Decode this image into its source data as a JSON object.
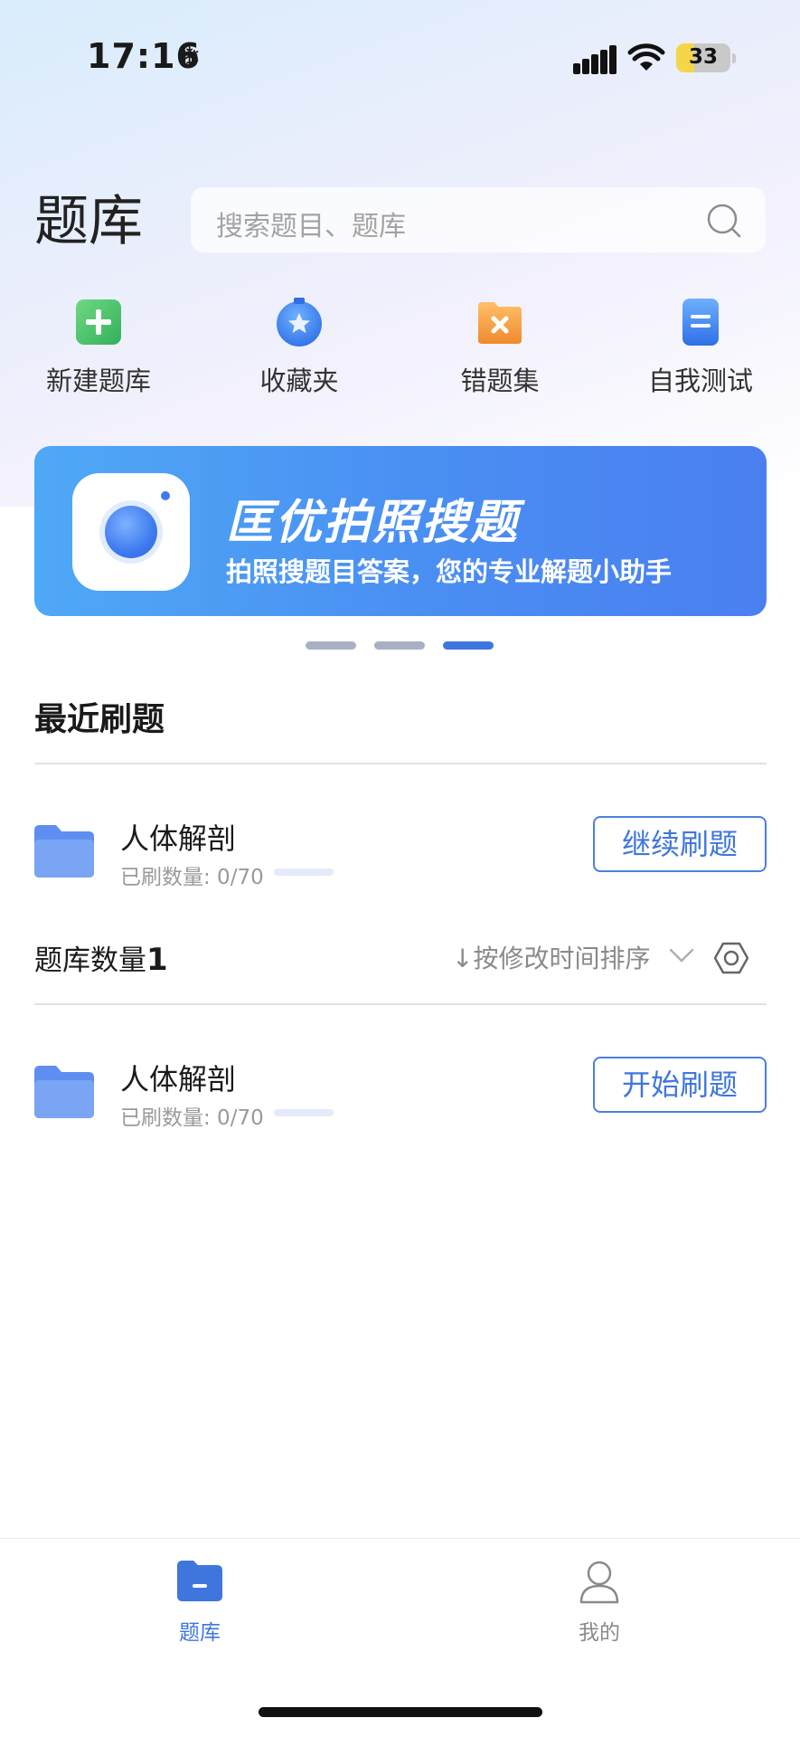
{
  "status_bar": {
    "time": "17:16",
    "time_icon": "snowflake-icon",
    "battery": "33",
    "battery_level": 0.33
  },
  "header": {
    "title": "题库",
    "search_placeholder": "搜索题目、题库"
  },
  "shortcuts": [
    {
      "label": "新建题库",
      "icon": "add-bank-icon",
      "color": "#48c46a"
    },
    {
      "label": "收藏夹",
      "icon": "favorites-star-icon",
      "color": "#3a86f0"
    },
    {
      "label": "错题集",
      "icon": "wrong-questions-icon",
      "color": "#f39a3c"
    },
    {
      "label": "自我测试",
      "icon": "self-test-icon",
      "color": "#3d82f2"
    }
  ],
  "banner": {
    "title": "匡优拍照搜题",
    "subtitle": "拍照搜题目答案，您的专业解题小助手",
    "active_slide": 3,
    "slide_count": 3
  },
  "recent": {
    "title": "最近刷题",
    "items": [
      {
        "name": "人体解剖",
        "count": "已刷数量: 0/70",
        "progress": 0,
        "button": "继续刷题"
      }
    ]
  },
  "banks": {
    "title_prefix": "题库数量",
    "count": "1",
    "sort_label": "↓按修改时间排序",
    "items": [
      {
        "name": "人体解剖",
        "count": "已刷数量: 0/70",
        "progress": 0,
        "button": "开始刷题"
      }
    ]
  },
  "tabs": [
    {
      "label": "题库",
      "icon": "folder-icon",
      "active": true
    },
    {
      "label": "我的",
      "icon": "user-icon",
      "active": false
    }
  ],
  "colors": {
    "accent": "#3f76de",
    "folder": "#7aa5f5",
    "inactive_tab": "#8a8a8a"
  }
}
